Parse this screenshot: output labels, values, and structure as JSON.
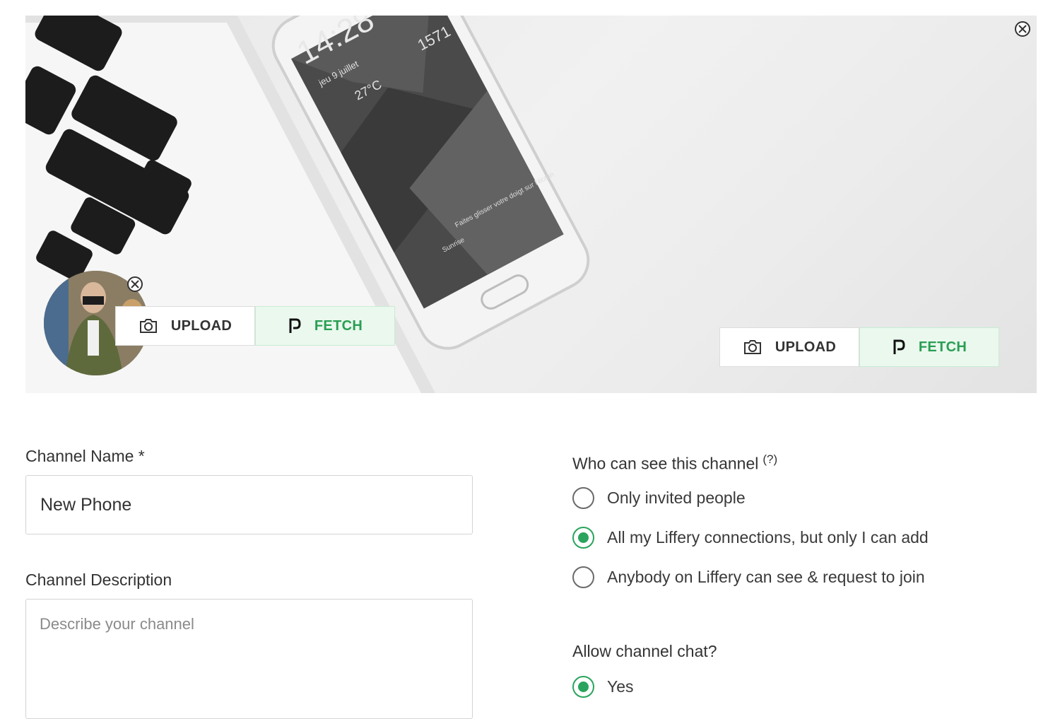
{
  "cover": {
    "phone_time": "14:28",
    "phone_date": "jeu 9 juillet",
    "phone_temp": "27°C",
    "phone_steps": "1571",
    "phone_hint": "Faites glisser votre doigt sur l'écran",
    "phone_weather": "Sunrise"
  },
  "avatar_controls": {
    "upload_label": "UPLOAD",
    "fetch_label": "FETCH"
  },
  "cover_controls": {
    "upload_label": "UPLOAD",
    "fetch_label": "FETCH"
  },
  "form": {
    "channel_name_label": "Channel Name *",
    "channel_name_value": "New Phone",
    "channel_description_label": "Channel Description",
    "channel_description_placeholder": "Describe your channel",
    "visibility_label": "Who can see this channel",
    "visibility_help": "(?)",
    "visibility_options": [
      {
        "label": "Only invited people",
        "checked": false
      },
      {
        "label": "All my Liffery connections, but only I can add",
        "checked": true
      },
      {
        "label": "Anybody on Liffery can see & request to join",
        "checked": false
      }
    ],
    "chat_label": "Allow channel chat?",
    "chat_options": [
      {
        "label": "Yes",
        "checked": true
      }
    ]
  },
  "colors": {
    "accent_green": "#2aa45e",
    "fetch_bg": "#eaf8ee"
  },
  "icons": [
    "close-icon",
    "camera-icon",
    "fetch-icon"
  ]
}
